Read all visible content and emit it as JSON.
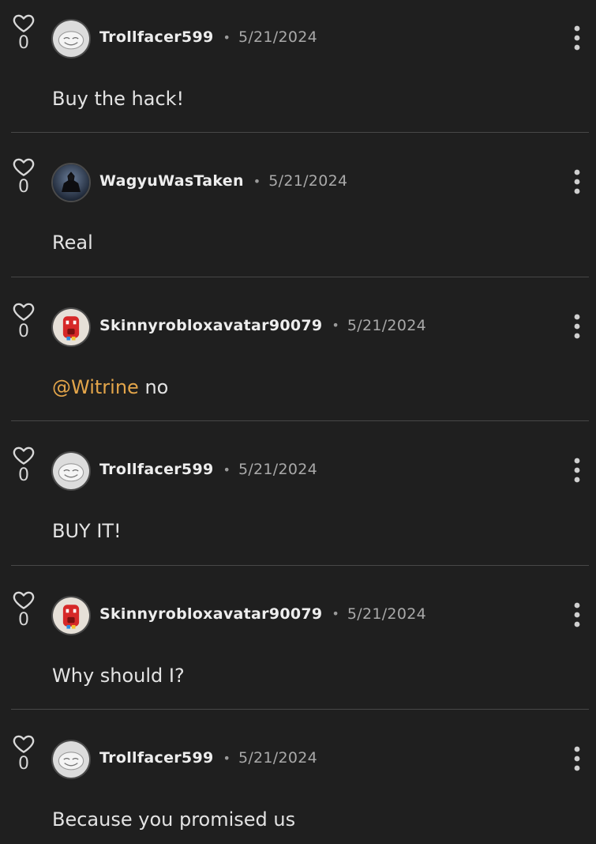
{
  "comments": [
    {
      "likes": "0",
      "username": "Trollfacer599",
      "date": "5/21/2024",
      "avatar": "trollface-avatar",
      "mention": "",
      "text": "Buy the hack!"
    },
    {
      "likes": "0",
      "username": "WagyuWasTaken",
      "date": "5/21/2024",
      "avatar": "dark-figure-avatar",
      "mention": "",
      "text": "Real"
    },
    {
      "likes": "0",
      "username": "Skinnyrobloxavatar90079",
      "date": "5/21/2024",
      "avatar": "red-robot-avatar",
      "mention": "@Witrine",
      "text": "no"
    },
    {
      "likes": "0",
      "username": "Trollfacer599",
      "date": "5/21/2024",
      "avatar": "trollface-avatar",
      "mention": "",
      "text": "BUY IT!"
    },
    {
      "likes": "0",
      "username": "Skinnyrobloxavatar90079",
      "date": "5/21/2024",
      "avatar": "red-robot-avatar",
      "mention": "",
      "text": "Why should I?"
    },
    {
      "likes": "0",
      "username": "Trollfacer599",
      "date": "5/21/2024",
      "avatar": "trollface-avatar",
      "mention": "",
      "text": "Because you promised us"
    }
  ],
  "separator": "•",
  "icons": {
    "like": "heart-outline-icon",
    "menu": "kebab-menu-icon"
  },
  "colors": {
    "background": "#1f1f1f",
    "mention": "#e3a54a",
    "divider": "#474747"
  }
}
